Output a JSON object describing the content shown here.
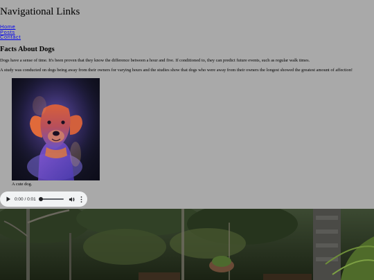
{
  "header": {
    "title": "Navigational Links"
  },
  "nav": {
    "links": [
      {
        "label": "Home"
      },
      {
        "label": "Posts"
      },
      {
        "label": "Contact"
      }
    ]
  },
  "article": {
    "heading": "Facts About Dogs",
    "paragraphs": [
      "Dogs have a sense of time. It's been proven that they know the difference between a hour and five. If conditioned to, they can predict future events, such as regular walk times.",
      "A study was conducted on dogs being away from their owners for varying hours and the studies show that dogs who were away from their owners the longest showed the greatest amount of affection!"
    ]
  },
  "figure": {
    "caption": "A cute dog."
  },
  "audio": {
    "time": "0:00 / 0:01",
    "progress": 0,
    "icons": {
      "play": "play-icon",
      "volume": "volume-icon",
      "more": "more-options-icon"
    }
  },
  "colors": {
    "page_background": "#a9a9a9",
    "link": "#0000ee",
    "player_background": "#f1f3f4"
  }
}
